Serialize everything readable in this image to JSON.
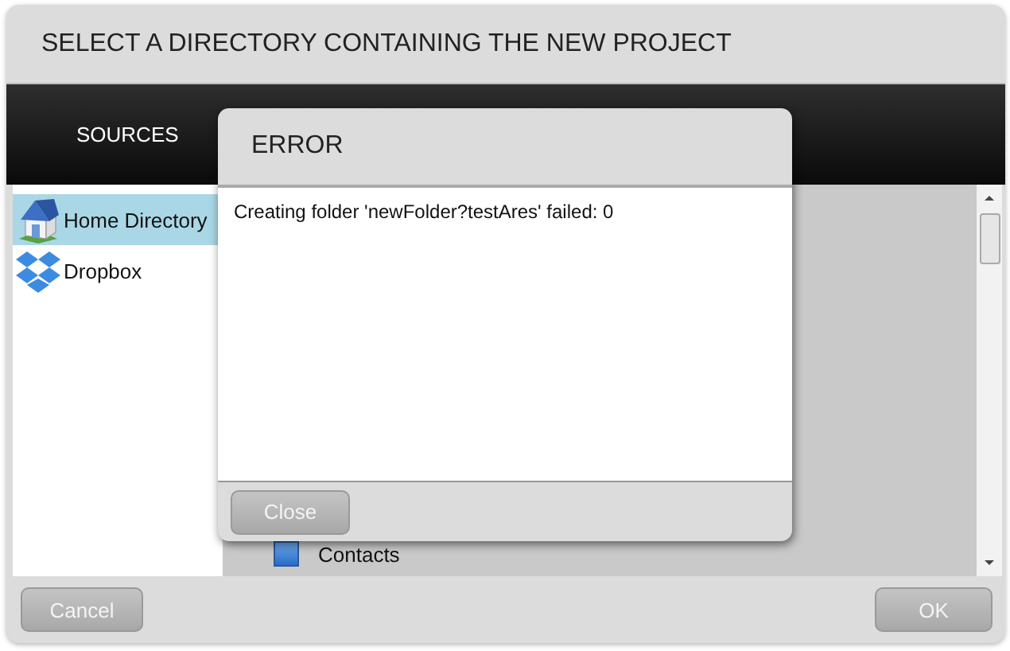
{
  "window": {
    "title": "SELECT A DIRECTORY CONTAINING THE NEW PROJECT"
  },
  "sources": {
    "heading": "SOURCES",
    "items": [
      {
        "label": "Home Directory",
        "kind": "home",
        "selected": true
      },
      {
        "label": "Dropbox",
        "kind": "dropbox",
        "selected": false
      }
    ]
  },
  "folders": [
    {
      "label": "Contacts"
    }
  ],
  "error_dialog": {
    "title": "ERROR",
    "message": "Creating folder 'newFolder?testAres' failed: 0",
    "button": "Close"
  },
  "buttons": [
    {
      "label": "Cancel",
      "kind": "cancel"
    },
    {
      "label": "OK",
      "kind": "ok"
    }
  ]
}
